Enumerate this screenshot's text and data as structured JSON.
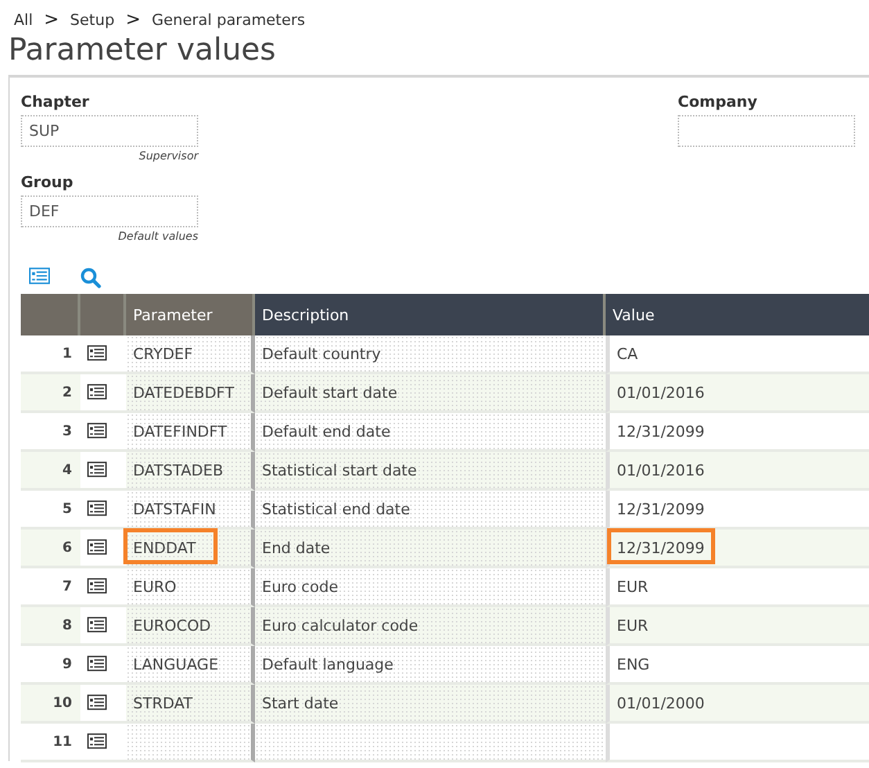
{
  "breadcrumb": [
    "All",
    "Setup",
    "General parameters"
  ],
  "breadcrumb_separator": ">",
  "title": "Parameter values",
  "fields": [
    {
      "label": "Chapter",
      "value": "SUP",
      "caption": "Supervisor"
    },
    {
      "label": "Company"
    },
    {
      "label": "Group",
      "value": "DEF",
      "caption": "Default values"
    }
  ],
  "table": {
    "columns": [
      "Parameter",
      "Description",
      "Value"
    ],
    "rows": [
      {
        "number": "1",
        "parameter": "CRYDEF",
        "description": "Default country",
        "value": "CA",
        "parameter_highlighted": false,
        "value_highlighted": false
      },
      {
        "number": "2",
        "parameter": "DATEDEBDFT",
        "description": "Default start date",
        "value": "01/01/2016",
        "parameter_highlighted": false,
        "value_highlighted": false
      },
      {
        "number": "3",
        "parameter": "DATEFINDFT",
        "description": "Default end date",
        "value": "12/31/2099",
        "parameter_highlighted": false,
        "value_highlighted": false
      },
      {
        "number": "4",
        "parameter": "DATSTADEB",
        "description": "Statistical start date",
        "value": "01/01/2016",
        "parameter_highlighted": false,
        "value_highlighted": false
      },
      {
        "number": "5",
        "parameter": "DATSTAFIN",
        "description": "Statistical end date",
        "value": "12/31/2099",
        "parameter_highlighted": false,
        "value_highlighted": false
      },
      {
        "number": "6",
        "parameter": "ENDDAT",
        "description": "End date",
        "value": "12/31/2099",
        "parameter_highlighted": true,
        "value_highlighted": true
      },
      {
        "number": "7",
        "parameter": "EURO",
        "description": "Euro code",
        "value": "EUR",
        "parameter_highlighted": false,
        "value_highlighted": false
      },
      {
        "number": "8",
        "parameter": "EUROCOD",
        "description": "Euro calculator code",
        "value": "EUR",
        "parameter_highlighted": false,
        "value_highlighted": false
      },
      {
        "number": "9",
        "parameter": "LANGUAGE",
        "description": "Default language",
        "value": "ENG",
        "parameter_highlighted": false,
        "value_highlighted": false
      },
      {
        "number": "10",
        "parameter": "STRDAT",
        "description": "Start date",
        "value": "01/01/2000",
        "parameter_highlighted": false,
        "value_highlighted": false
      },
      {
        "number": "11"
      }
    ]
  }
}
